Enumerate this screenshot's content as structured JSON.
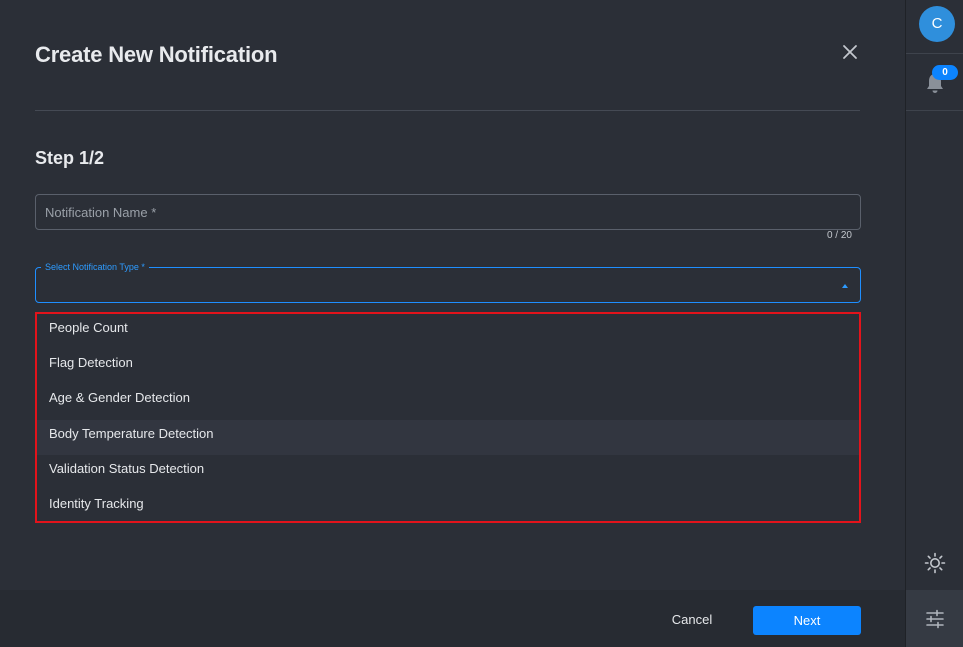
{
  "dialog": {
    "title": "Create New Notification",
    "step": "Step 1/2",
    "name_field": {
      "placeholder": "Notification Name *",
      "value": "",
      "counter": "0 / 20"
    },
    "type_field": {
      "label": "Select Notification Type *",
      "value": ""
    },
    "dropdown_items": [
      {
        "label": "People Count"
      },
      {
        "label": "Flag Detection"
      },
      {
        "label": "Age & Gender Detection"
      },
      {
        "label": "Body Temperature Detection"
      },
      {
        "label": "Validation Status Detection"
      },
      {
        "label": "Identity Tracking"
      }
    ],
    "hovered_item_index": 3,
    "cancel_label": "Cancel",
    "next_label": "Next"
  },
  "rail": {
    "avatar_initial": "C",
    "notification_count": "0"
  },
  "colors": {
    "background": "#2b2f37",
    "accent": "#0c84ff",
    "highlight_border": "#e3131b"
  },
  "icons": [
    "close-icon",
    "chevron-up-icon",
    "bell-icon",
    "sun-icon",
    "sliders-icon"
  ]
}
